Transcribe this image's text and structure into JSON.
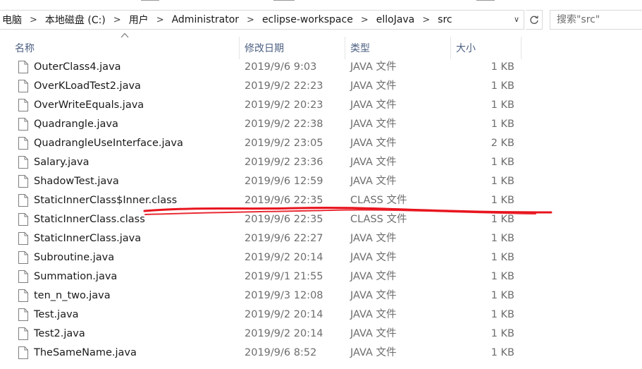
{
  "address": {
    "crumbs": [
      "电脑",
      "本地磁盘 (C:)",
      "用户",
      "Administrator",
      "eclipse-workspace",
      "elloJava",
      "src"
    ]
  },
  "search": {
    "placeholder": "搜索\"src\""
  },
  "columns": {
    "name": "名称",
    "date": "修改日期",
    "type": "类型",
    "size": "大小"
  },
  "files": [
    {
      "name": "OuterClass4.java",
      "date": "2019/9/6 9:03",
      "type": "JAVA 文件",
      "size": "1 KB"
    },
    {
      "name": "OverKLoadTest2.java",
      "date": "2019/9/2 22:23",
      "type": "JAVA 文件",
      "size": "1 KB"
    },
    {
      "name": "OverWriteEquals.java",
      "date": "2019/9/2 20:23",
      "type": "JAVA 文件",
      "size": "1 KB"
    },
    {
      "name": "Quadrangle.java",
      "date": "2019/9/2 22:38",
      "type": "JAVA 文件",
      "size": "1 KB"
    },
    {
      "name": "QuadrangleUseInterface.java",
      "date": "2019/9/2 23:05",
      "type": "JAVA 文件",
      "size": "2 KB"
    },
    {
      "name": "Salary.java",
      "date": "2019/9/2 23:36",
      "type": "JAVA 文件",
      "size": "1 KB"
    },
    {
      "name": "ShadowTest.java",
      "date": "2019/9/6 12:59",
      "type": "JAVA 文件",
      "size": "1 KB"
    },
    {
      "name": "StaticInnerClass$Inner.class",
      "date": "2019/9/6 22:35",
      "type": "CLASS 文件",
      "size": "1 KB"
    },
    {
      "name": "StaticInnerClass.class",
      "date": "2019/9/6 22:35",
      "type": "CLASS 文件",
      "size": "1 KB"
    },
    {
      "name": "StaticInnerClass.java",
      "date": "2019/9/6 22:27",
      "type": "JAVA 文件",
      "size": "1 KB"
    },
    {
      "name": "Subroutine.java",
      "date": "2019/9/2 20:14",
      "type": "JAVA 文件",
      "size": "1 KB"
    },
    {
      "name": "Summation.java",
      "date": "2019/9/1 21:55",
      "type": "JAVA 文件",
      "size": "1 KB"
    },
    {
      "name": "ten_n_two.java",
      "date": "2019/9/3 12:08",
      "type": "JAVA 文件",
      "size": "1 KB"
    },
    {
      "name": "Test.java",
      "date": "2019/9/2 20:14",
      "type": "JAVA 文件",
      "size": "1 KB"
    },
    {
      "name": "Test2.java",
      "date": "2019/9/2 20:14",
      "type": "JAVA 文件",
      "size": "1 KB"
    },
    {
      "name": "TheSameName.java",
      "date": "2019/9/6 8:52",
      "type": "JAVA 文件",
      "size": "1 KB"
    }
  ],
  "colors": {
    "annotation": "#e8141e",
    "header_text": "#4d6082",
    "secondary_text": "#6d6d6d"
  }
}
